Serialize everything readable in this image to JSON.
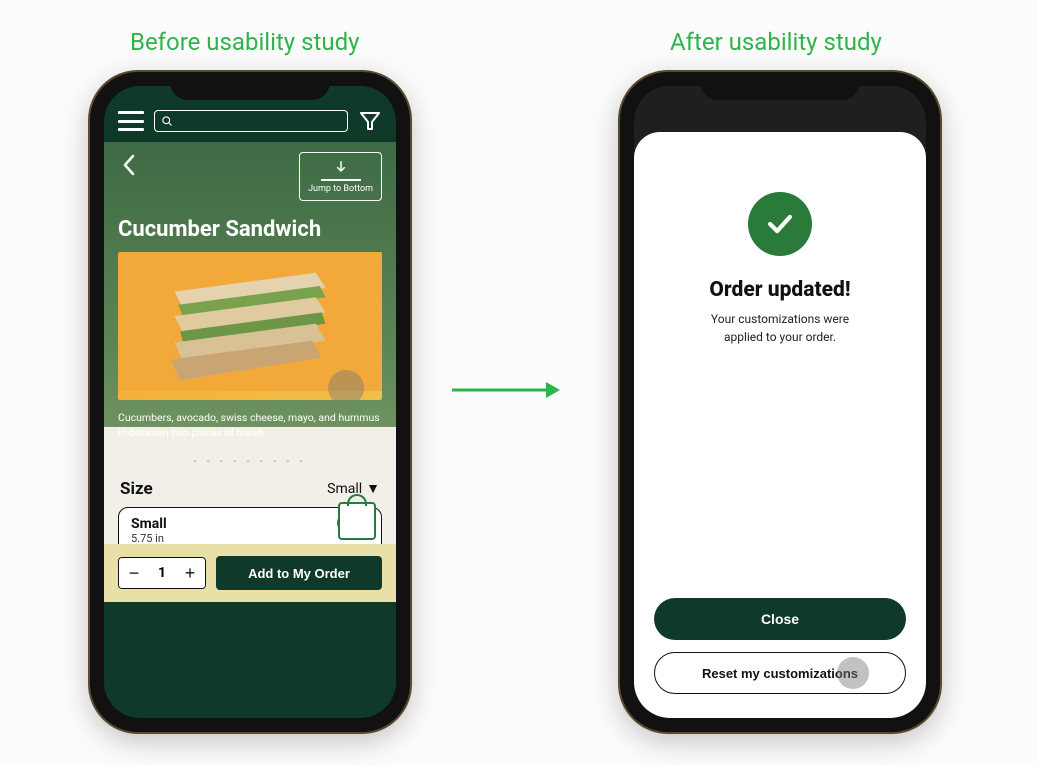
{
  "labels": {
    "before": "Before usability study",
    "after": "After usability study"
  },
  "before": {
    "jump_label": "Jump to Bottom",
    "product_title": "Cucumber Sandwich",
    "product_desc": "Cucumbers, avocado, swiss cheese, mayo, and hummus in between two pieces of bread.",
    "size_label": "Size",
    "size_selected": "Small",
    "size_option": {
      "name": "Small",
      "dim": "5.75 in"
    },
    "qty": "1",
    "add_label": "Add to My Order",
    "dots": "- - - - - - - - -"
  },
  "after": {
    "title": "Order updated!",
    "subtitle_line1": "Your customizations were",
    "subtitle_line2": "applied to your order.",
    "close_label": "Close",
    "reset_label": "Reset my customizations"
  }
}
